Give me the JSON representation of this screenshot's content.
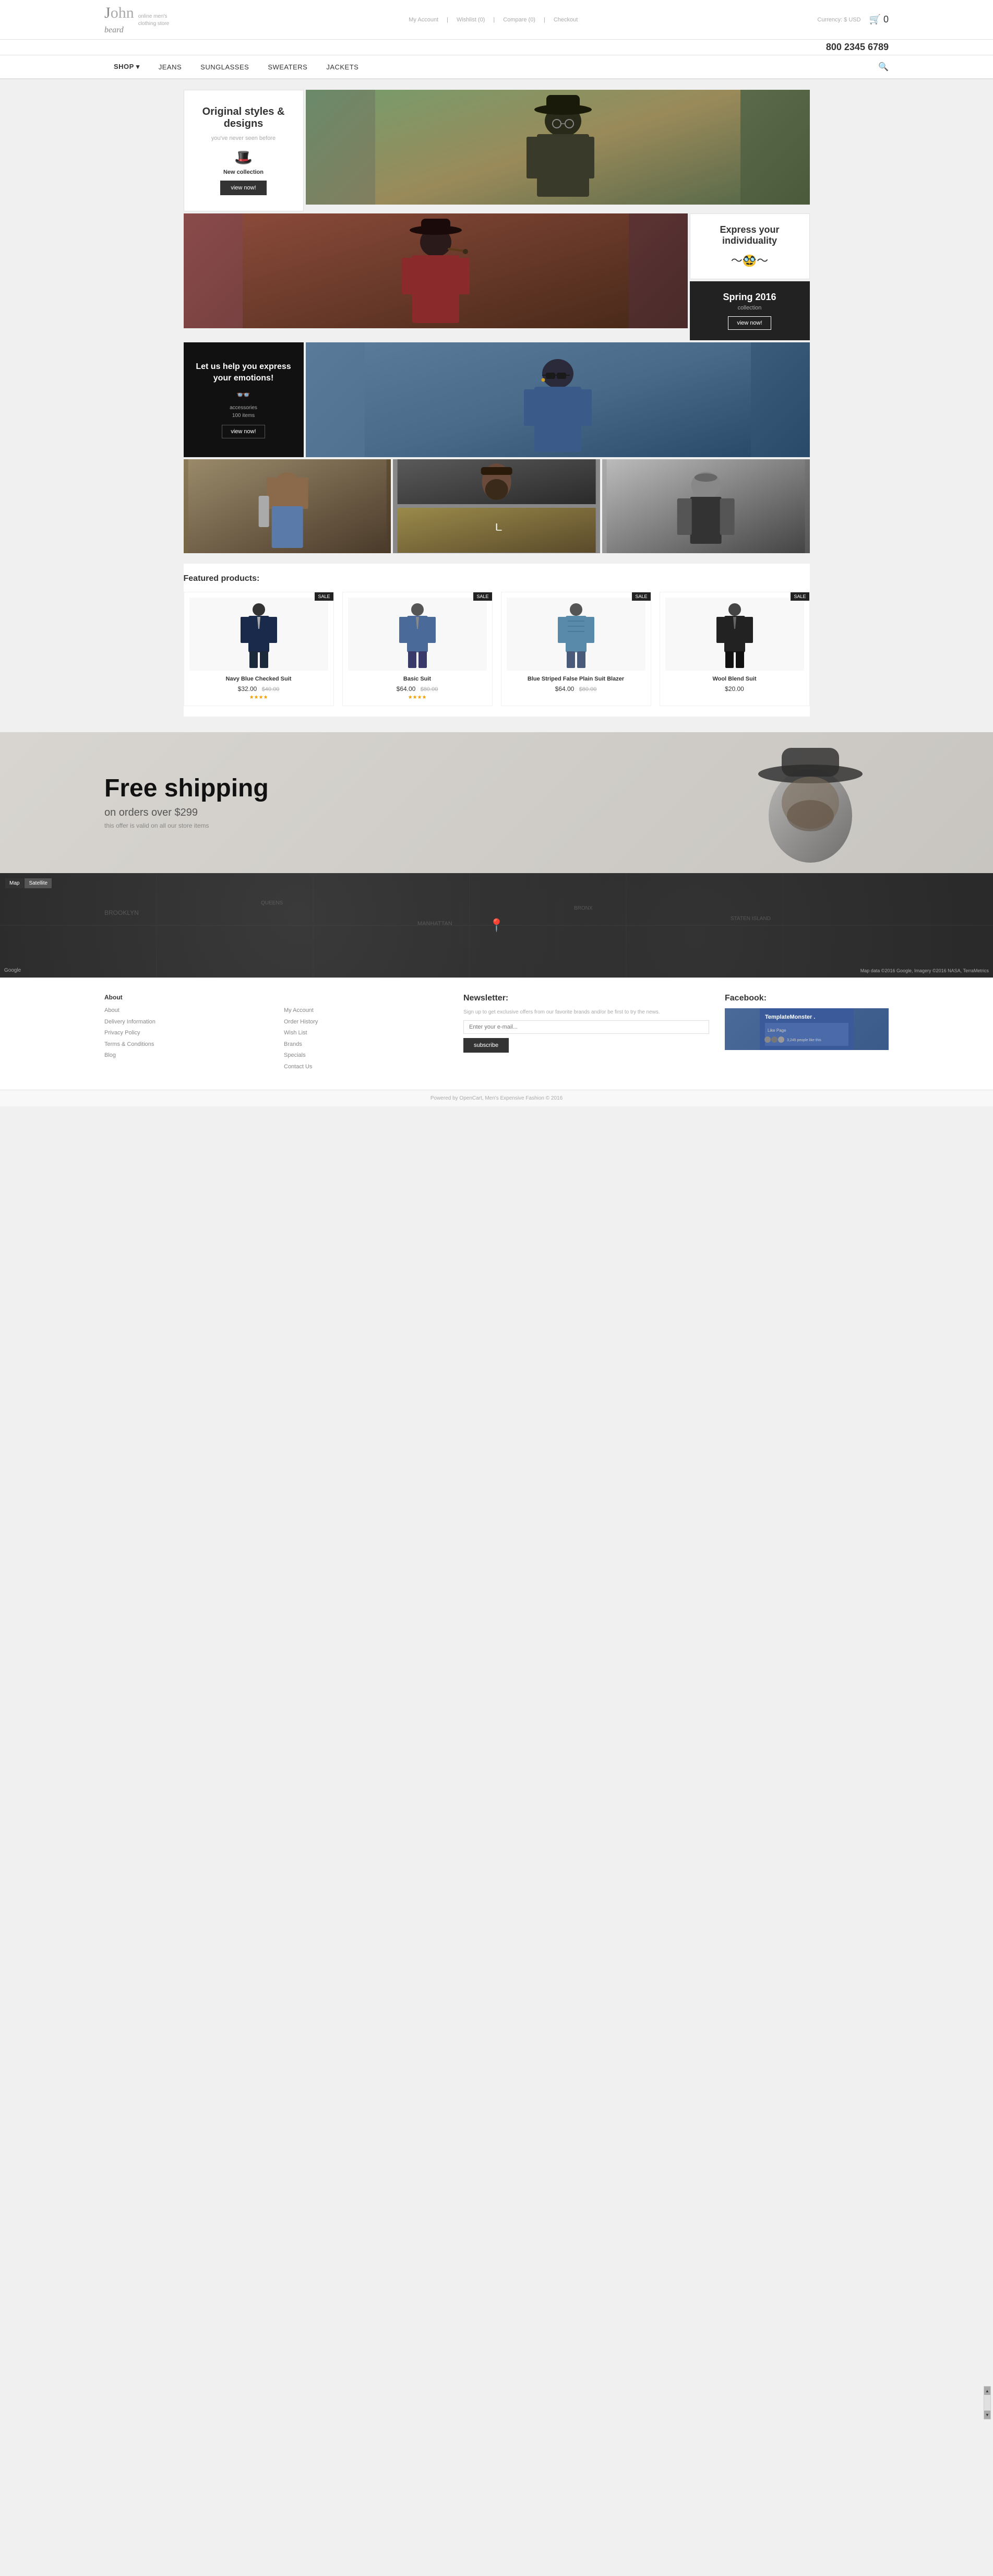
{
  "header": {
    "logo": {
      "name_part1": "J",
      "name_part2": "hn",
      "name_accent": "o",
      "beard": "beard",
      "tagline_line1": "online men's",
      "tagline_line2": "clothing store"
    },
    "top_menu": {
      "my_account": "My Account",
      "wishlist": "Wishlist (0)",
      "compare": "Compare (0)",
      "checkout": "Checkout"
    },
    "currency_label": "Currency: $ USD",
    "cart_label": "0",
    "phone": "800 2345 6789"
  },
  "nav": {
    "items": [
      {
        "label": "Shop",
        "has_dropdown": true
      },
      {
        "label": "Jeans",
        "has_dropdown": false
      },
      {
        "label": "Sunglasses",
        "has_dropdown": false
      },
      {
        "label": "Sweaters",
        "has_dropdown": false
      },
      {
        "label": "Jackets",
        "has_dropdown": false
      }
    ],
    "search_placeholder": "Search..."
  },
  "hero": {
    "text_box": {
      "title": "Original styles & designs",
      "subtitle": "you've never seen before",
      "label": "New collection",
      "btn": "view now!"
    }
  },
  "second_row": {
    "express_box": {
      "title": "Express your individuality"
    },
    "spring_box": {
      "title": "Spring 2016",
      "subtitle": "collection",
      "btn": "view now!"
    }
  },
  "accessories_box": {
    "title": "Let us help you express your emotions!",
    "category": "accessories",
    "items_count": "100 items",
    "btn": "view now!"
  },
  "featured": {
    "title": "Featured products:",
    "products": [
      {
        "name": "Navy Blue Checked Suit",
        "price": "$32.00",
        "old_price": "$40.00",
        "has_sale": true,
        "stars": "★★★★"
      },
      {
        "name": "Basic Suit",
        "price": "$64.00",
        "old_price": "$80.00",
        "has_sale": true,
        "stars": "★★★★"
      },
      {
        "name": "Blue Striped False Plain Suit Blazer",
        "price": "$64.00",
        "old_price": "$80.00",
        "has_sale": true,
        "stars": ""
      },
      {
        "name": "Wool Blend Suit",
        "price": "$20.00",
        "old_price": "",
        "has_sale": true,
        "stars": ""
      }
    ]
  },
  "shipping_banner": {
    "title": "Free shipping",
    "subtitle": "on orders over $299",
    "subtext": "this offer is valid on all our store items"
  },
  "map": {
    "tabs": [
      "Map",
      "Satellite"
    ]
  },
  "footer": {
    "columns": {
      "about": {
        "title": "About",
        "links": [
          "About",
          "Delivery Information",
          "Privacy Policy",
          "Terms & Conditions",
          "Blog"
        ]
      },
      "account": {
        "title": "",
        "links": [
          "My Account",
          "Order History",
          "Wish List",
          "Brands",
          "Specials",
          "Contact Us"
        ]
      },
      "newsletter": {
        "title": "Newsletter:",
        "text": "Sign up to get exclusive offers from our favorite brands and/or be first to try the news.",
        "placeholder": "Enter your e-mail...",
        "btn": "subscribe"
      },
      "facebook": {
        "title": "Facebook:"
      }
    }
  },
  "bottom_footer": {
    "text": "Powered by OpenCart, Men's Expensive Fashion © 2016"
  },
  "colors": {
    "dark": "#222222",
    "accent": "#333333",
    "light_bg": "#f0f0f0",
    "border": "#e0e0e0"
  }
}
